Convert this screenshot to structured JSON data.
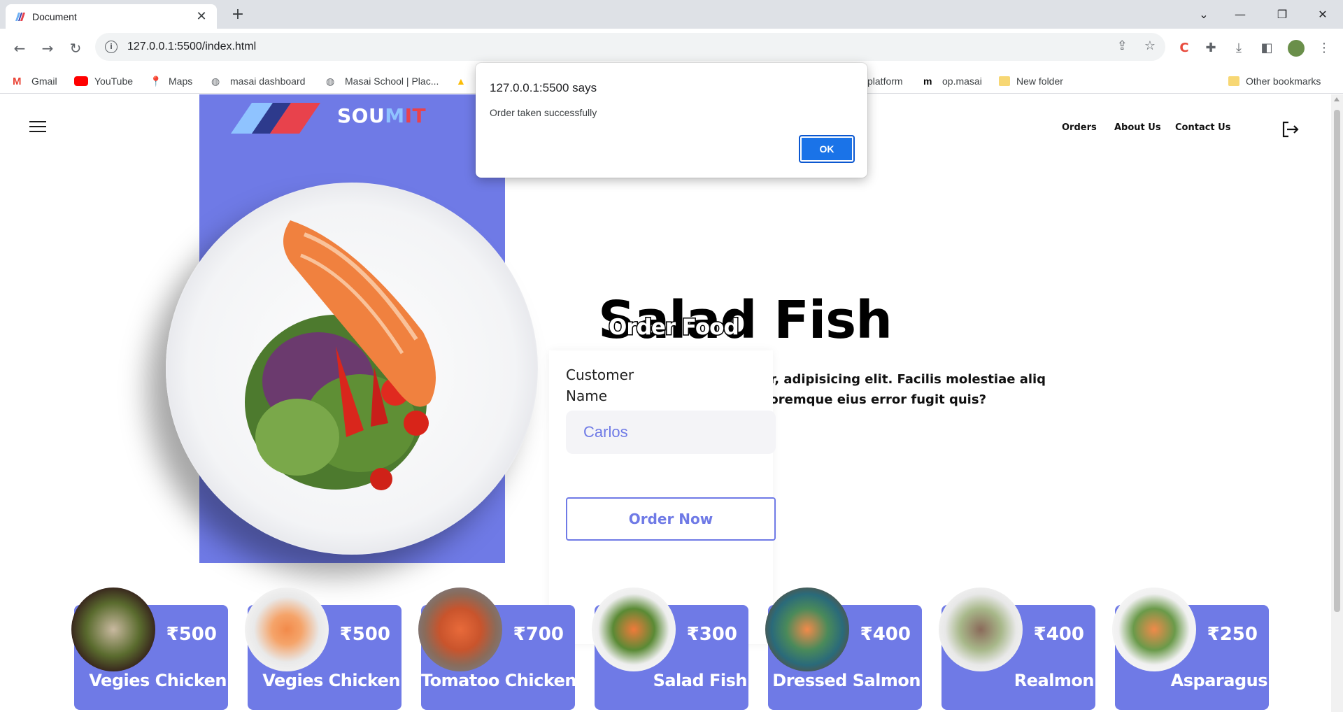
{
  "browser": {
    "tab_title": "Document",
    "url": "127.0.0.1:5500/index.html",
    "bookmarks": [
      "Gmail",
      "YouTube",
      "Maps",
      "masai dashboard",
      "Masai School | Plac...",
      "platform",
      "op.masai",
      "New folder"
    ],
    "other_bookmarks": "Other bookmarks"
  },
  "dialog": {
    "title": "127.0.0.1:5500 says",
    "message": "Order taken successfully",
    "ok_label": "OK"
  },
  "site": {
    "brand_so": "SOU",
    "brand_m": "M",
    "brand_it": "IT",
    "nav": [
      "Orders",
      "About Us",
      "Contact Us"
    ]
  },
  "hero": {
    "title": "Salad Fish",
    "overlay_text": "Order Food",
    "description_line1": "onsectetur, adipisicing elit. Facilis molestiae aliq",
    "description_line2": "olores doloremque eius error fugit quis?"
  },
  "order_form": {
    "label": "Customer Name",
    "value": "Carlos",
    "button": "Order Now"
  },
  "menu_cards": [
    {
      "price": "₹500",
      "name": "Vegies Chicken"
    },
    {
      "price": "₹500",
      "name": "Vegies Chicken"
    },
    {
      "price": "₹700",
      "name": "Tomatoo Chicken"
    },
    {
      "price": "₹300",
      "name": "Salad Fish"
    },
    {
      "price": "₹400",
      "name": "Dressed Salmon"
    },
    {
      "price": "₹400",
      "name": "Realmon"
    },
    {
      "price": "₹250",
      "name": "Asparagus"
    }
  ],
  "colors": {
    "accent": "#6f7ae6",
    "dialog_button": "#1a73e8"
  }
}
